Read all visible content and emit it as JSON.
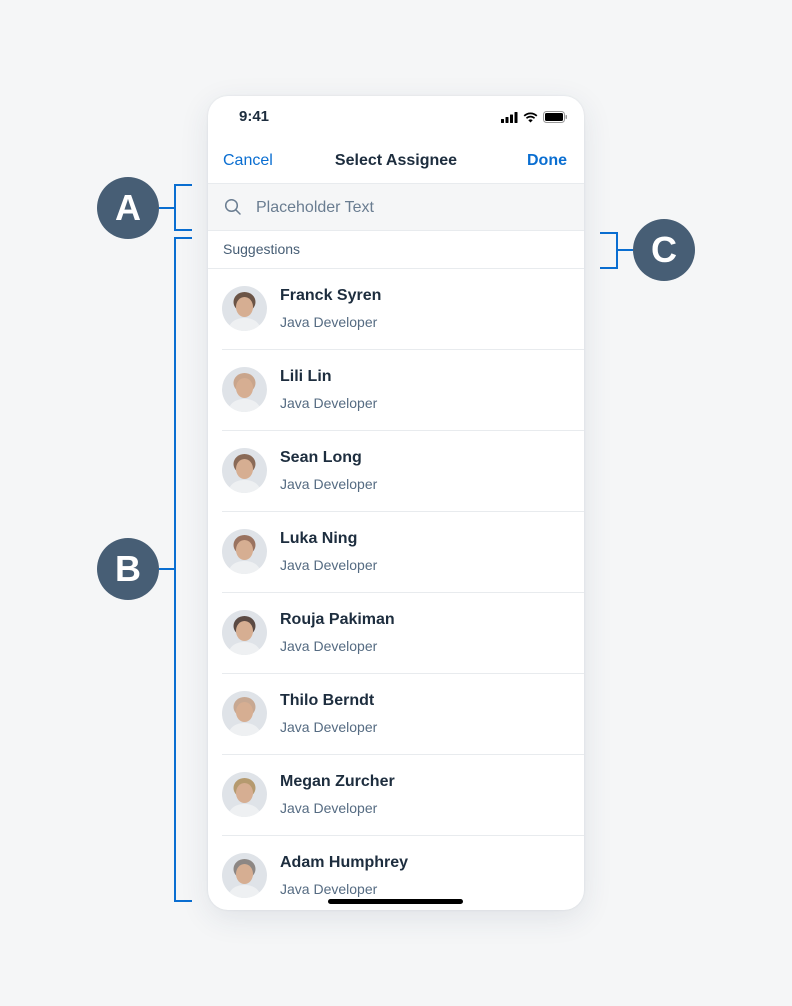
{
  "status_bar": {
    "time": "9:41"
  },
  "nav": {
    "cancel": "Cancel",
    "title": "Select Assignee",
    "done": "Done"
  },
  "search": {
    "placeholder": "Placeholder Text",
    "value": ""
  },
  "section": {
    "label": "Suggestions"
  },
  "people": [
    {
      "name": "Franck Syren",
      "role": "Java Developer",
      "tone": "#6b5446"
    },
    {
      "name": "Lili Lin",
      "role": "Java Developer",
      "tone": "#c9a58c"
    },
    {
      "name": "Sean Long",
      "role": "Java Developer",
      "tone": "#8a6a57"
    },
    {
      "name": "Luka Ning",
      "role": "Java Developer",
      "tone": "#9a7360"
    },
    {
      "name": "Rouja Pakiman",
      "role": "Java Developer",
      "tone": "#5b4a44"
    },
    {
      "name": "Thilo Berndt",
      "role": "Java Developer",
      "tone": "#c7a892"
    },
    {
      "name": "Megan Zurcher",
      "role": "Java Developer",
      "tone": "#b59a6f"
    },
    {
      "name": "Adam Humphrey",
      "role": "Java Developer",
      "tone": "#8d8784"
    }
  ],
  "annotations": {
    "a": "A",
    "b": "B",
    "c": "C"
  },
  "colors": {
    "accent": "#0a6ed1",
    "bubble": "#475e75",
    "text": "#1d2d3e"
  }
}
